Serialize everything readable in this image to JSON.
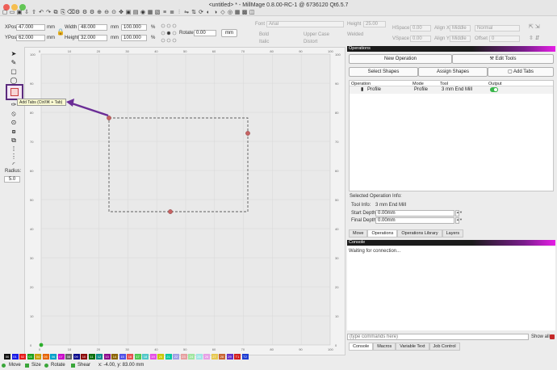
{
  "window": {
    "title": "<untitled> * - MillMage 0.8.00-RC-1 @ 6736120 Qt6.5.7"
  },
  "shape": {
    "xpos_label": "XPos",
    "xpos": "47.000",
    "xunit": "mm",
    "ypos_label": "YPos",
    "ypos": "62.000",
    "yunit": "mm",
    "width_label": "Width",
    "width": "48.000",
    "wunit": "mm",
    "wpct": "100.000",
    "wpct_unit": "%",
    "height_label": "Height",
    "height": "32.000",
    "hunit": "mm",
    "hpct": "100.000",
    "hpct_unit": "%",
    "rotate_label": "Rotate",
    "rotate": "0.00",
    "rotate_unit": "mm"
  },
  "text_tools": {
    "font_label": "Font",
    "font": "Arial",
    "height_label": "Height",
    "height": "25.00",
    "hspace_label": "HSpace",
    "hspace": "0.00",
    "vspace_label": "VSpace",
    "vspace": "0.00",
    "alignx_label": "Align X",
    "alignx": "Middle",
    "aligny_label": "Align Y",
    "aligny": "Middle",
    "style": "Normal",
    "offset_label": "Offset",
    "offset": "0",
    "bold": "Bold",
    "italic": "Italic",
    "upper": "Upper Case",
    "distort": "Distort",
    "welded": "Welded"
  },
  "left_tools": {
    "radius_label": "Radius:",
    "radius": "5.0",
    "tooltip": "Add Tabs (Ctrl/⌘ + Tab)"
  },
  "canvas": {
    "xticks": [
      "0",
      "10",
      "20",
      "30",
      "40",
      "50",
      "60",
      "70",
      "80",
      "90",
      "100"
    ],
    "yticks": [
      "100",
      "90",
      "80",
      "70",
      "60",
      "50",
      "40",
      "30",
      "20",
      "10",
      "0"
    ]
  },
  "operations": {
    "header": "Operations",
    "new_op": "New Operation",
    "edit_tools": "Edit Tools",
    "select_shapes": "Select Shapes",
    "assign_shapes": "Assign Shapes",
    "add_tabs": "Add Tabs",
    "columns": [
      "Operation",
      "Mode",
      "Tool",
      "Output"
    ],
    "rows": [
      {
        "operation": "Profile",
        "mode": "Profile",
        "tool": "3 mm End Mill"
      }
    ]
  },
  "op_info": {
    "header": "Selected Operation Info:",
    "tool_label": "Tool Info:",
    "tool": "3 mm End Mill",
    "start_label": "Start Depth:",
    "start": "0.00mm",
    "final_label": "Final Depth:",
    "final": "0.00mm"
  },
  "panel_tabs": [
    "Move",
    "Operations",
    "Operations Library",
    "Layers"
  ],
  "console": {
    "header": "Console",
    "text": "Waiting for connection...",
    "placeholder": "(type commands here)",
    "show_all": "Show all",
    "tabs": [
      "Console",
      "Macros",
      "Variable Text",
      "Job Control"
    ]
  },
  "palette": [
    {
      "label": "00",
      "color": "#111111"
    },
    {
      "label": "01",
      "color": "#1a1ae6"
    },
    {
      "label": "02",
      "color": "#e61a1a"
    },
    {
      "label": "03",
      "color": "#1aa01a"
    },
    {
      "label": "04",
      "color": "#c8a000"
    },
    {
      "label": "05",
      "color": "#e66400"
    },
    {
      "label": "06",
      "color": "#00a0c8"
    },
    {
      "label": "07",
      "color": "#c800c8"
    },
    {
      "label": "08",
      "color": "#646464"
    },
    {
      "label": "09",
      "color": "#0a0a8c"
    },
    {
      "label": "10",
      "color": "#8c0a0a"
    },
    {
      "label": "11",
      "color": "#0a6e0a"
    },
    {
      "label": "12",
      "color": "#0a8c8c"
    },
    {
      "label": "13",
      "color": "#8c0a8c"
    },
    {
      "label": "14",
      "color": "#8c6400"
    },
    {
      "label": "15",
      "color": "#5050e6"
    },
    {
      "label": "16",
      "color": "#e65050"
    },
    {
      "label": "17",
      "color": "#50c850"
    },
    {
      "label": "18",
      "color": "#50c8c8"
    },
    {
      "label": "19",
      "color": "#e650e6"
    },
    {
      "label": "20",
      "color": "#c8c800"
    },
    {
      "label": "21",
      "color": "#00c8a0"
    },
    {
      "label": "22",
      "color": "#a0a0e6"
    },
    {
      "label": "23",
      "color": "#e6a0a0"
    },
    {
      "label": "24",
      "color": "#a0e6a0"
    },
    {
      "label": "25",
      "color": "#a0e6e6"
    },
    {
      "label": "26",
      "color": "#e6a0e6"
    },
    {
      "label": "27",
      "color": "#e6c850"
    },
    {
      "label": "28",
      "color": "#c86432"
    },
    {
      "label": "29",
      "color": "#6432c8"
    },
    {
      "label": "T1",
      "color": "#d21e1e"
    },
    {
      "label": "T2",
      "color": "#1e3cd2"
    }
  ],
  "status": {
    "move": "Move",
    "size": "Size",
    "rotate": "Rotate",
    "shear": "Shear",
    "coords": "x: -4.00, y: 83.00 mm"
  }
}
